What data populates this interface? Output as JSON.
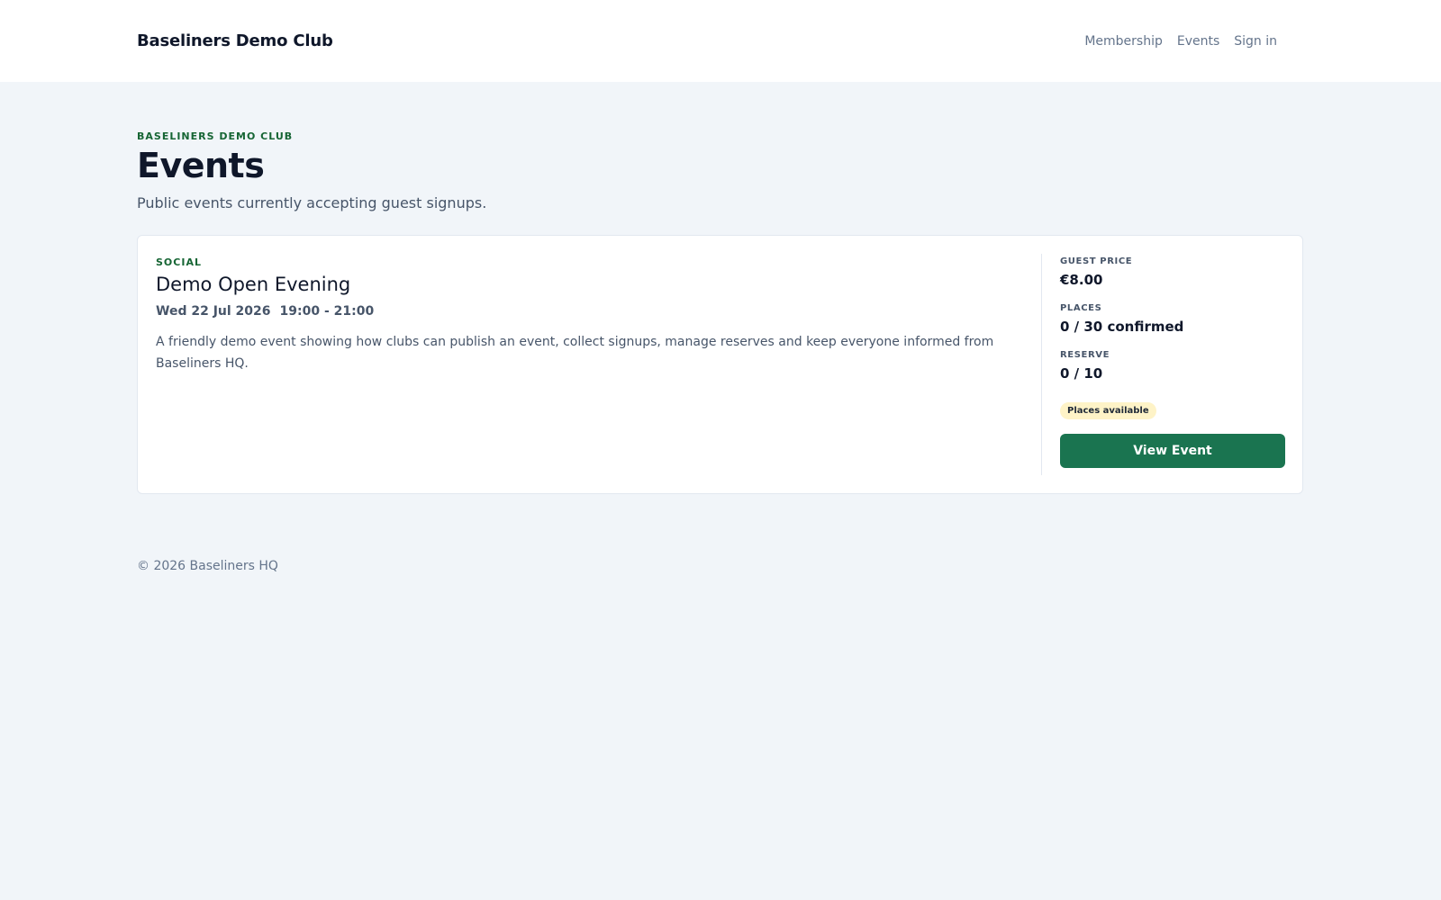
{
  "header": {
    "brand": "Baseliners Demo Club",
    "nav": [
      "Membership",
      "Events",
      "Sign in"
    ]
  },
  "page": {
    "eyebrow": "BASELINERS DEMO CLUB",
    "title": "Events",
    "subtitle": "Public events currently accepting guest signups."
  },
  "event": {
    "category": "SOCIAL",
    "title": "Demo Open Evening",
    "date": "Wed 22 Jul 2026",
    "time": "19:00 - 21:00",
    "description": "A friendly demo event showing how clubs can publish an event, collect signups, manage reserves and keep everyone informed from Baseliners HQ.",
    "stats": [
      {
        "label": "GUEST PRICE",
        "value": "€8.00"
      },
      {
        "label": "PLACES",
        "value": "0 / 30 confirmed"
      },
      {
        "label": "RESERVE",
        "value": "0 / 10"
      }
    ],
    "status": "Places available",
    "button": "View Event"
  },
  "footer": {
    "text": "© 2026 Baseliners HQ"
  },
  "colors": {
    "accent": "#1a7450",
    "badge_bg": "#fef3c7",
    "eyebrow": "#166534"
  }
}
